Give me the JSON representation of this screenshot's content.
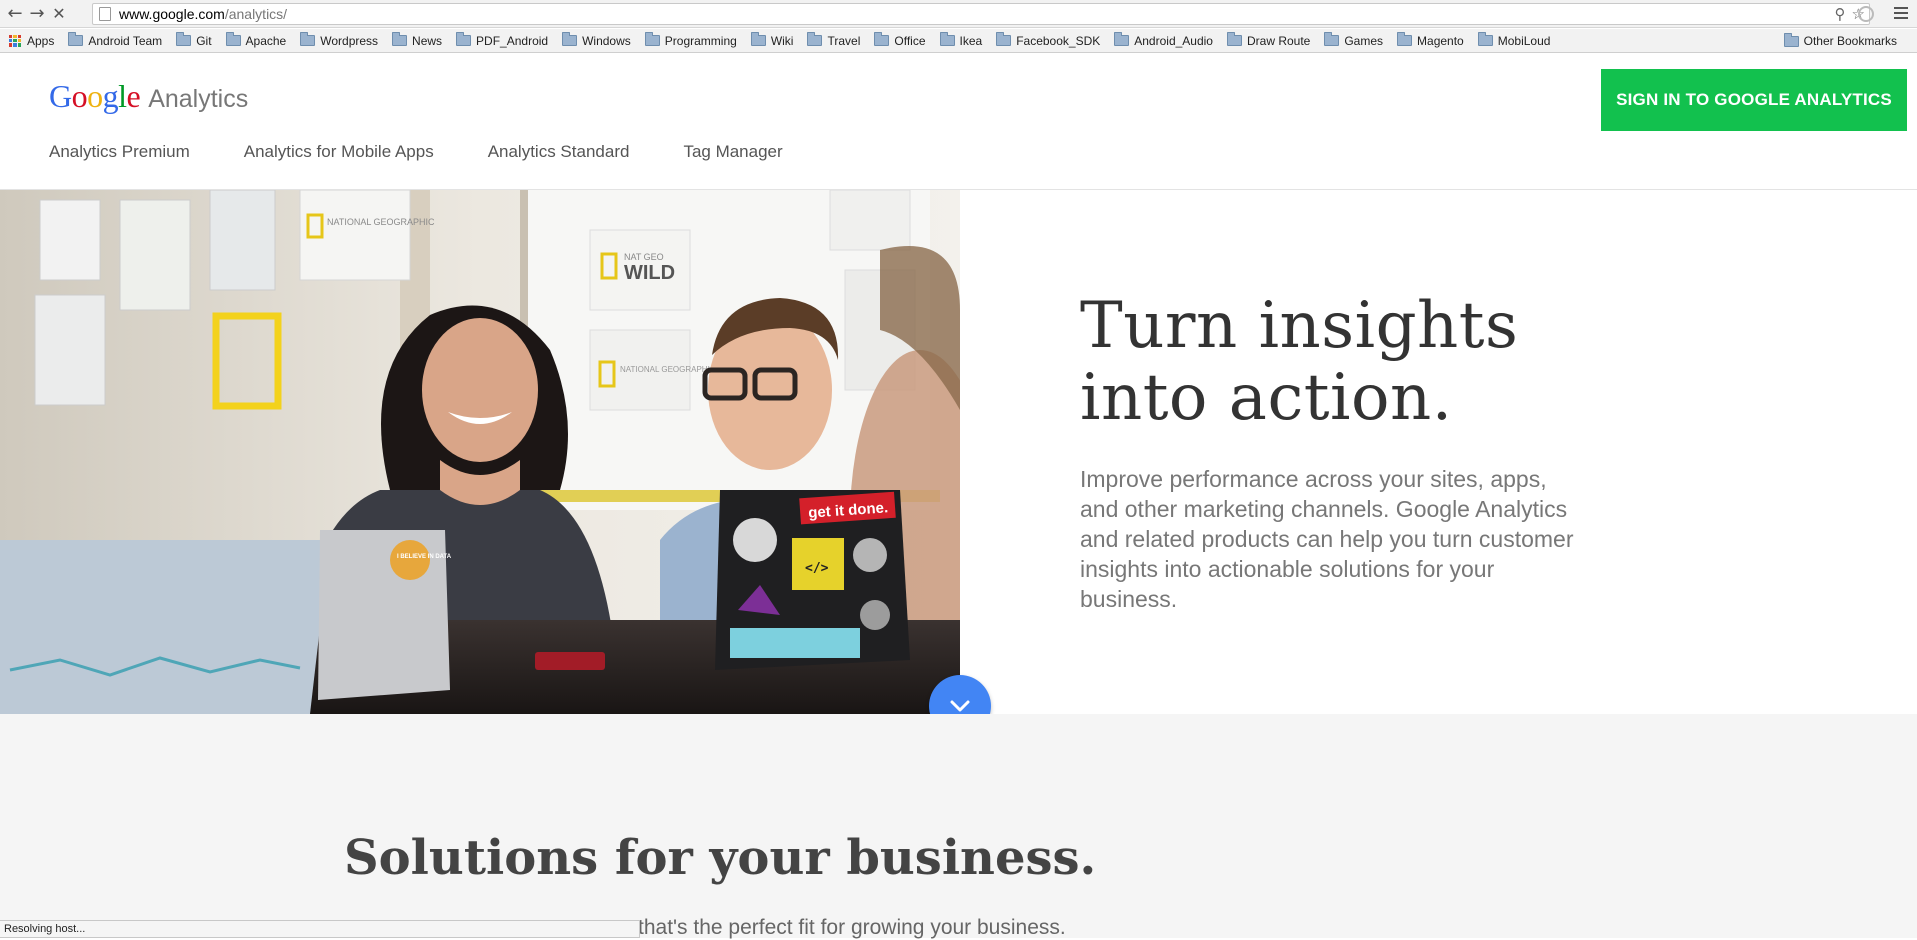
{
  "browser": {
    "url_host": "www.google.com",
    "url_path": "/analytics/",
    "status_text": "Resolving host...",
    "bookmarks": [
      "Apps",
      "Android Team",
      "Git",
      "Apache",
      "Wordpress",
      "News",
      "PDF_Android",
      "Windows",
      "Programming",
      "Wiki",
      "Travel",
      "Office",
      "Ikea",
      "Facebook_SDK",
      "Android_Audio",
      "Draw Route",
      "Games",
      "Magento",
      "MobiLoud"
    ],
    "other_bookmarks": "Other Bookmarks",
    "icons": {
      "back": "back-arrow-icon",
      "forward": "forward-arrow-icon",
      "stop": "stop-loading-icon",
      "zoom": "zoom-icon",
      "star": "star-icon",
      "menu": "hamburger-menu-icon"
    }
  },
  "header": {
    "logo_google": [
      "G",
      "o",
      "o",
      "g",
      "l",
      "e"
    ],
    "logo_product": "Analytics",
    "signin_label": "SIGN IN TO GOOGLE ANALYTICS",
    "nav": [
      "Analytics Premium",
      "Analytics for Mobile Apps",
      "Analytics Standard",
      "Tag Manager"
    ]
  },
  "hero": {
    "title_line1": "Turn insights",
    "title_line2": "into action.",
    "body": "Improve performance across your sites, apps, and other marketing channels. Google Analytics and related products can help you turn customer insights into actionable solutions for your business.",
    "image_text": {
      "poster1": "NATIONAL GEOGRAPHIC",
      "poster2_small": "NAT GEO",
      "poster2_big": "WILD",
      "poster3": "NATIONAL GEOGRAPHIC CHANNEL",
      "sticker1": "get it done.",
      "sticker2": "</>",
      "sticker3": "I BELIEVE IN DATA"
    }
  },
  "solutions": {
    "title": "Solutions for your business.",
    "subtitle": "that's the perfect fit for growing your business."
  },
  "colors": {
    "signin_bg": "#12c14e",
    "scroll_btn": "#4285f4",
    "section_bg": "#f5f5f5"
  }
}
